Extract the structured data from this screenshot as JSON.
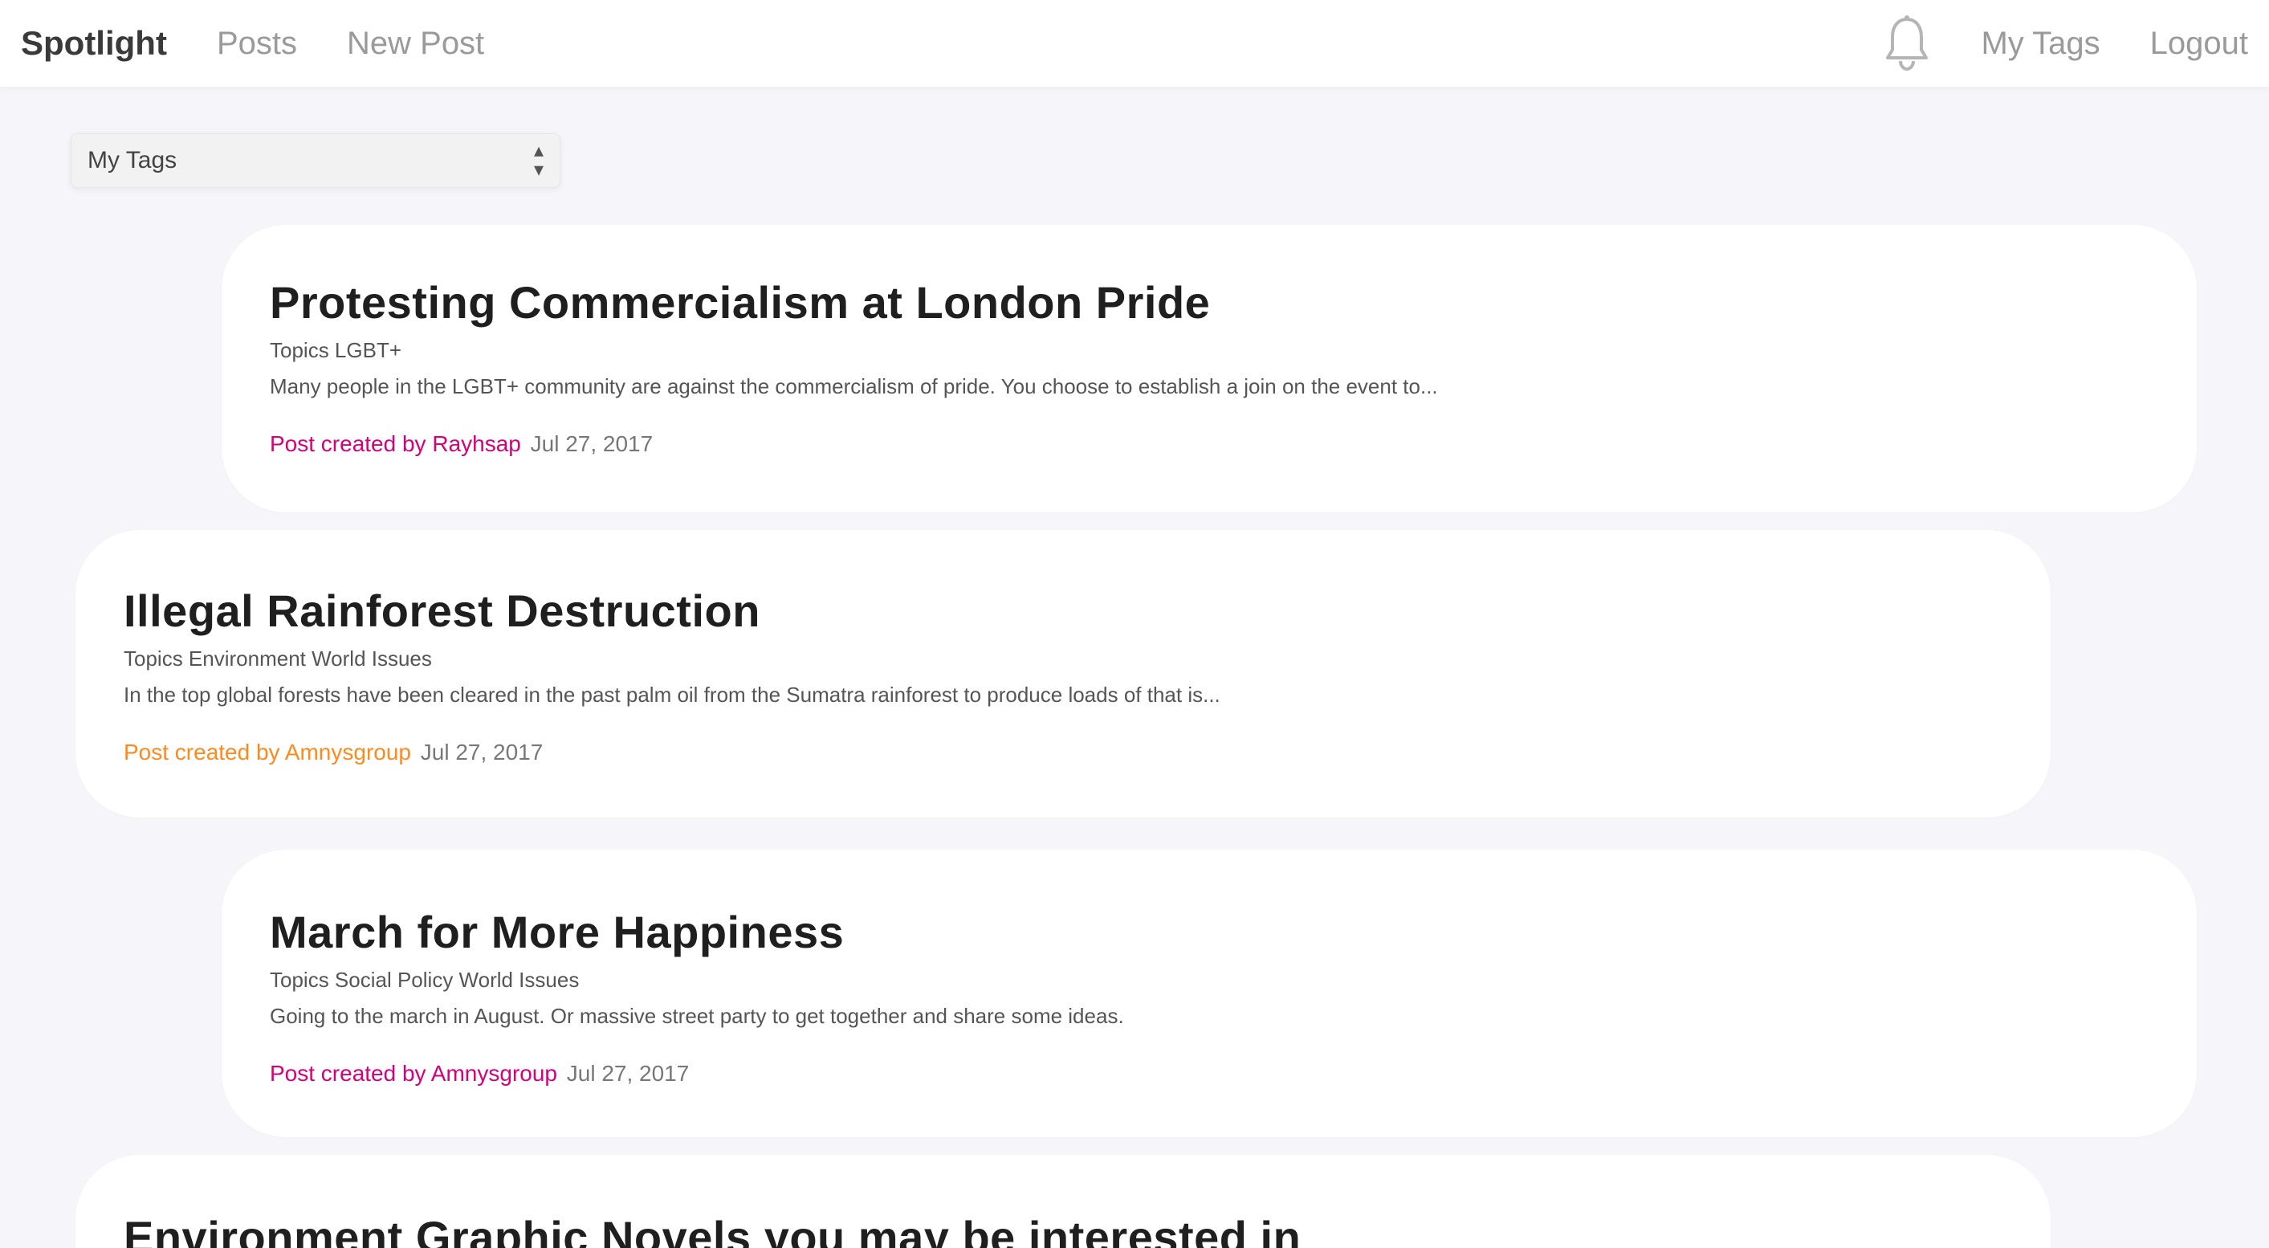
{
  "nav": {
    "brand": "Spotlight",
    "links": [
      "Posts",
      "New Post"
    ],
    "right_links": [
      "My Tags",
      "Logout"
    ],
    "bell_icon": "bell-icon"
  },
  "filter": {
    "selected": "My Tags"
  },
  "posts": [
    {
      "title": "Protesting Commercialism at London Pride",
      "topics": "Topics LGBT+",
      "excerpt": "Many people in the LGBT+ community are against the commercialism of pride. You choose to establish a join on the event to...",
      "created_label": "Post created by",
      "author": "Rayhsap",
      "date": "Jul 27, 2017",
      "accent": "#d6007a"
    },
    {
      "title": "Illegal Rainforest Destruction",
      "topics": "Topics Environment World Issues",
      "excerpt": "In the top global forests have been cleared in the past palm oil from the Sumatra rainforest to produce loads of that is...",
      "created_label": "Post created by",
      "author": "Amnysgroup",
      "date": "Jul 27, 2017",
      "accent": "#ff8a1c"
    },
    {
      "title": "March for More Happiness",
      "topics": "Topics Social Policy World Issues",
      "excerpt": "Going to the march in August. Or massive street party to get together and share some ideas.",
      "created_label": "Post created by",
      "author": "Amnysgroup",
      "date": "Jul 27, 2017",
      "accent": "#d6007a"
    },
    {
      "title": "Environment Graphic Novels you may be interested in"
    }
  ]
}
